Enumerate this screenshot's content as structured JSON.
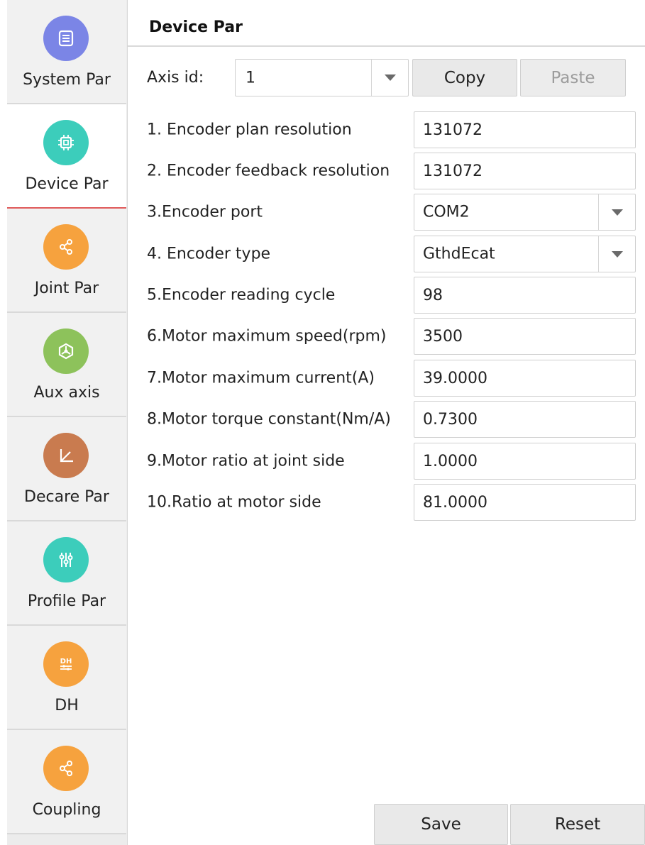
{
  "sidebar": {
    "items": [
      {
        "label": "System Par",
        "icon": "settings-list-icon",
        "color": "#7b85e6",
        "active": false
      },
      {
        "label": "Device Par",
        "icon": "chip-icon",
        "color": "#3ccdbb",
        "active": true
      },
      {
        "label": "Joint Par",
        "icon": "share-nodes-icon",
        "color": "#f6a23e",
        "active": false
      },
      {
        "label": "Aux axis",
        "icon": "hub-icon",
        "color": "#8dc25b",
        "active": false
      },
      {
        "label": "Decare Par",
        "icon": "axes-icon",
        "color": "#c97b4f",
        "active": false
      },
      {
        "label": "Profile Par",
        "icon": "sliders-icon",
        "color": "#3ccdbb",
        "active": false
      },
      {
        "label": "DH",
        "icon": "dh-icon",
        "color": "#f6a23e",
        "active": false
      },
      {
        "label": "Coupling",
        "icon": "share-nodes-icon",
        "color": "#f6a23e",
        "active": false
      }
    ]
  },
  "header": {
    "title": "Device Par"
  },
  "axis": {
    "label": "Axis id:",
    "value": "1"
  },
  "toolbar": {
    "copy_label": "Copy",
    "paste_label": "Paste",
    "save_label": "Save",
    "reset_label": "Reset"
  },
  "params": [
    {
      "label": "1. Encoder plan resolution",
      "value": "131072",
      "type": "input"
    },
    {
      "label": "2. Encoder feedback resolution",
      "value": "131072",
      "type": "input"
    },
    {
      "label": "3.Encoder port",
      "value": "COM2",
      "type": "select"
    },
    {
      "label": "4. Encoder type",
      "value": "GthdEcat",
      "type": "select"
    },
    {
      "label": "5.Encoder reading cycle",
      "value": "98",
      "type": "input"
    },
    {
      "label": "6.Motor maximum speed(rpm)",
      "value": "3500",
      "type": "input"
    },
    {
      "label": "7.Motor maximum current(A)",
      "value": "39.0000",
      "type": "input"
    },
    {
      "label": "8.Motor torque constant(Nm/A)",
      "value": "0.7300",
      "type": "input"
    },
    {
      "label": "9.Motor ratio at joint side",
      "value": "1.0000",
      "type": "input"
    },
    {
      "label": "10.Ratio at motor side",
      "value": "81.0000",
      "type": "input"
    }
  ],
  "colors": {
    "active_indicator": "#e05a5a"
  }
}
